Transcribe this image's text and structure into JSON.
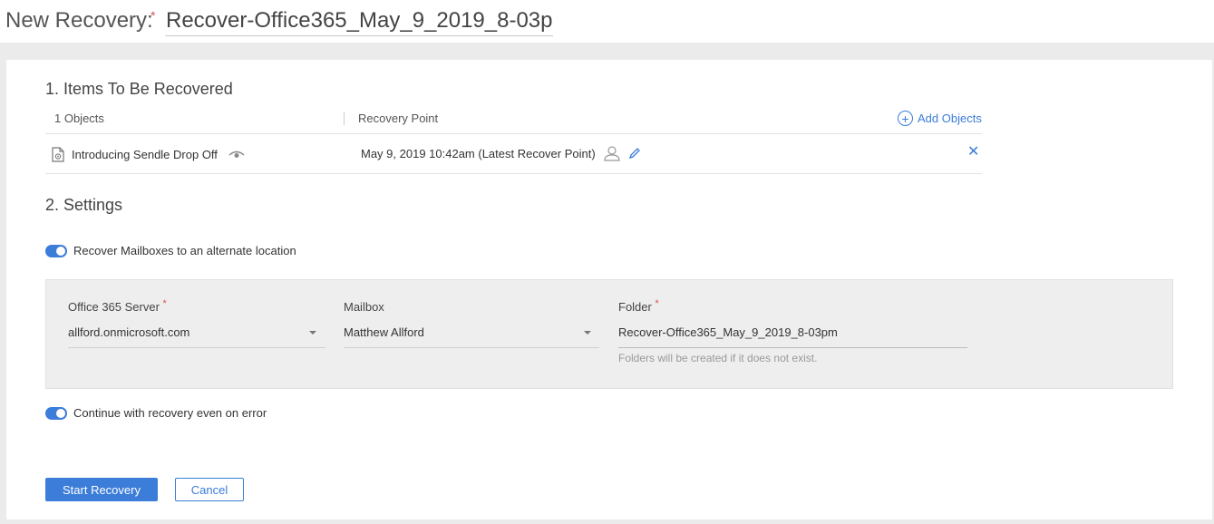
{
  "header": {
    "title_label": "New Recovery:",
    "required_mark": "*",
    "recovery_name": "Recover-Office365_May_9_2019_8-03pm"
  },
  "items_section": {
    "title": "1. Items To Be Recovered",
    "objects_count_label": "1 Objects",
    "recovery_point_header": "Recovery Point",
    "add_objects_label": "Add Objects",
    "rows": [
      {
        "name": "Introducing Sendle Drop Off",
        "recovery_point": "May 9, 2019 10:42am (Latest Recover Point)"
      }
    ]
  },
  "settings_section": {
    "title": "2. Settings",
    "alternate_location_toggle": {
      "label": "Recover Mailboxes to an alternate location",
      "enabled": true
    },
    "server_field": {
      "label": "Office 365 Server",
      "required_mark": "*",
      "value": "allford.onmicrosoft.com"
    },
    "mailbox_field": {
      "label": "Mailbox",
      "value": "Matthew Allford"
    },
    "folder_field": {
      "label": "Folder",
      "required_mark": "*",
      "value": "Recover-Office365_May_9_2019_8-03pm",
      "hint": "Folders will be created if it does not exist."
    },
    "continue_on_error_toggle": {
      "label": "Continue with recovery even on error",
      "enabled": true
    }
  },
  "actions": {
    "start_label": "Start Recovery",
    "cancel_label": "Cancel"
  },
  "colors": {
    "accent": "#3b7dd8",
    "required": "#d9534f"
  },
  "icons": {
    "document": "document-icon",
    "preview": "eye-icon",
    "user_recovery_point": "user-icon",
    "edit": "pencil-icon",
    "remove": "close-icon",
    "add": "plus-circle-icon",
    "dropdown": "chevron-down-icon"
  }
}
